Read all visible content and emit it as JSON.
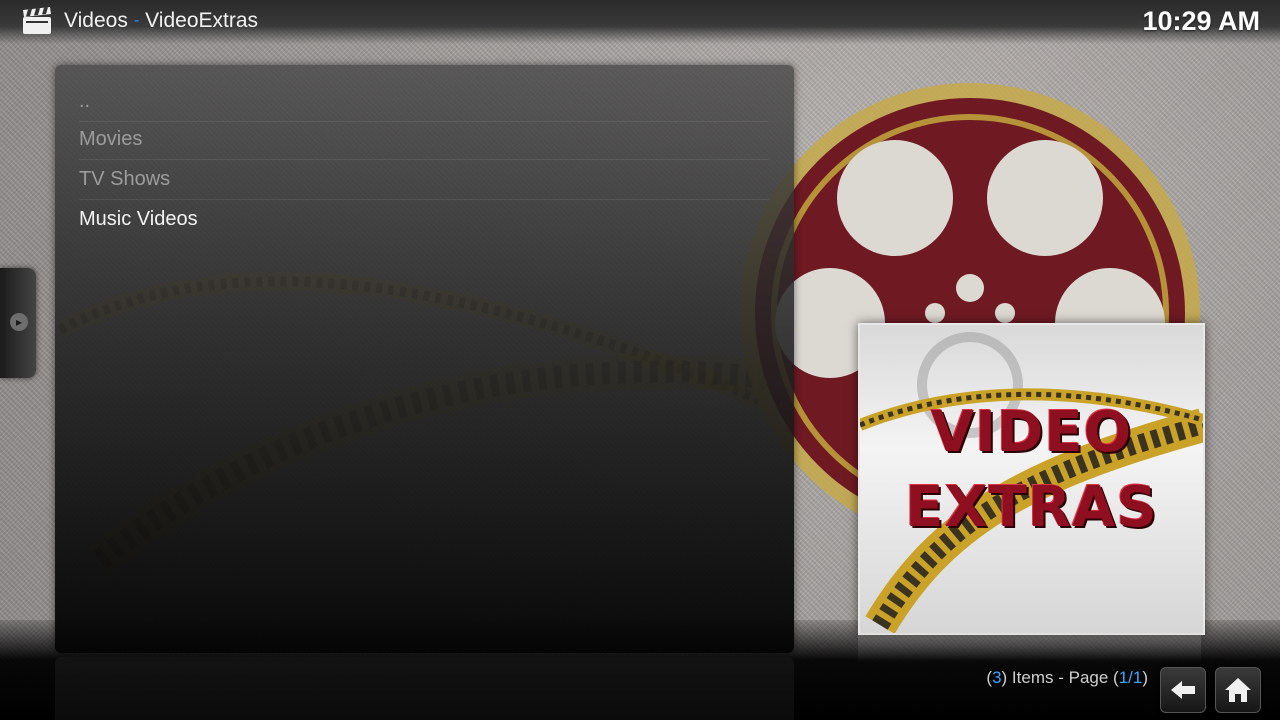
{
  "header": {
    "section": "Videos",
    "separator": "-",
    "addon": "VideoExtras",
    "clock": "10:29 AM"
  },
  "list": {
    "items": [
      {
        "label": ".."
      },
      {
        "label": "Movies"
      },
      {
        "label": "TV Shows"
      },
      {
        "label": "Music Videos"
      }
    ],
    "selected": "Music Videos"
  },
  "poster": {
    "line1": "VIDEO",
    "line2": "EXTRAS"
  },
  "footer": {
    "count_open": "(",
    "count": "3",
    "count_mid": ") Items - Page (",
    "page": "1/1",
    "count_close": ")"
  },
  "icons": {
    "header_icon": "clapperboard-icon",
    "side_tab": "chevron-right-icon",
    "back": "back-arrow-icon",
    "home": "home-icon"
  },
  "colors": {
    "accent": "#1e90ff",
    "poster_title": "#8e1020",
    "reel_red": "#7a1a22",
    "film_gold": "#c9a227"
  }
}
